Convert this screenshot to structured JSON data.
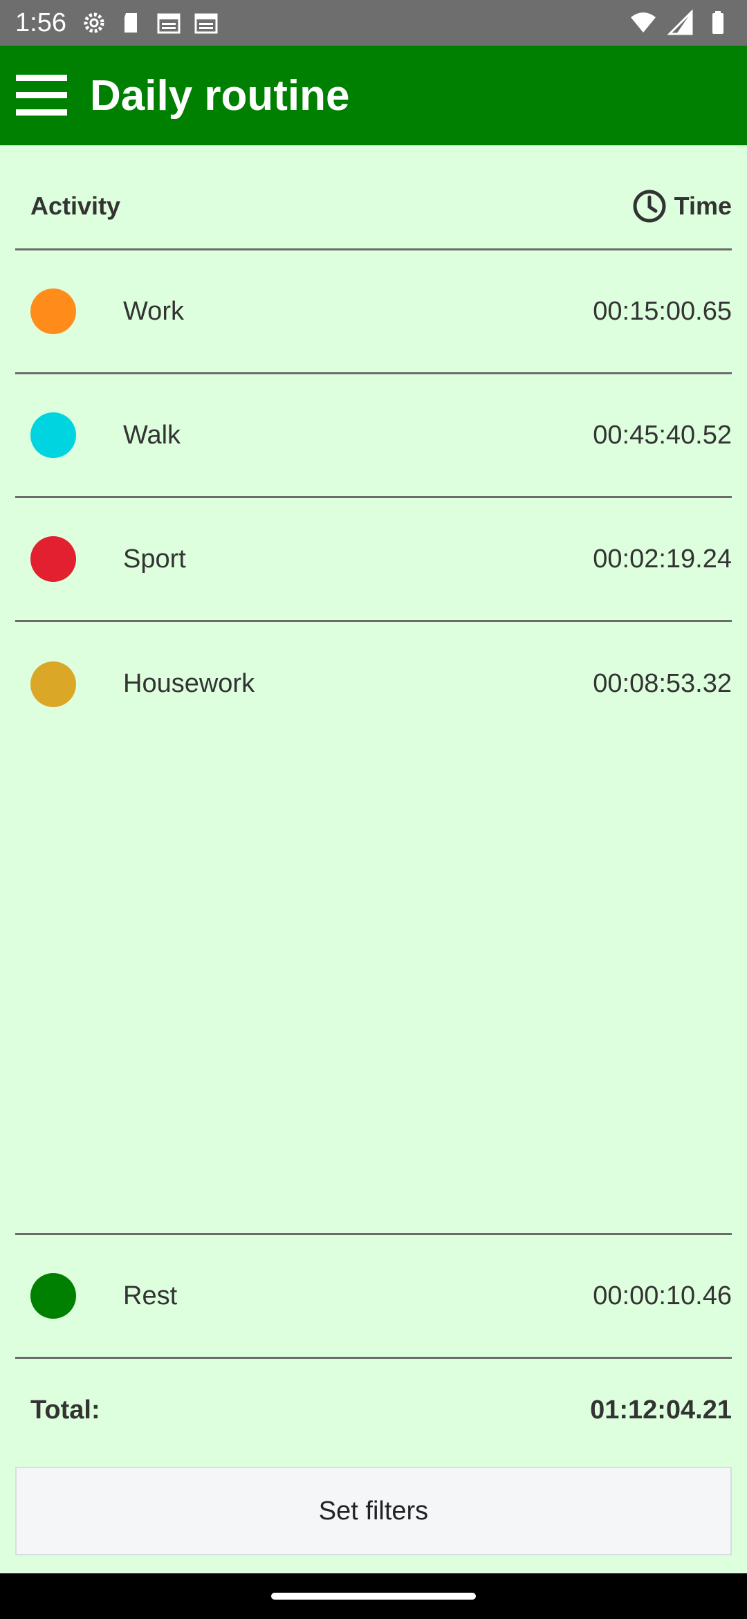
{
  "status_bar": {
    "time": "1:56",
    "left_icons": [
      "gear-icon",
      "sd-card-icon",
      "calendar-icon",
      "calendar-icon"
    ],
    "right_icons": [
      "wifi-icon",
      "signal-icon",
      "battery-icon"
    ]
  },
  "app_bar": {
    "title": "Daily routine",
    "menu_icon": "hamburger-menu-icon",
    "color": "#008000"
  },
  "table": {
    "header_activity": "Activity",
    "header_time": "Time",
    "time_icon": "clock-icon",
    "rows": [
      {
        "name": "Work",
        "time": "00:15:00.65",
        "color": "#ff8c1a"
      },
      {
        "name": "Walk",
        "time": "00:45:40.52",
        "color": "#00d4e0"
      },
      {
        "name": "Sport",
        "time": "00:02:19.24",
        "color": "#e3202f"
      },
      {
        "name": "Housework",
        "time": "00:08:53.32",
        "color": "#dba726"
      }
    ],
    "rest": {
      "name": "Rest",
      "time": "00:00:10.46",
      "color": "#008000"
    },
    "total_label": "Total:",
    "total_value": "01:12:04.21"
  },
  "actions": {
    "filters_label": "Set filters"
  },
  "background": "#ddffdd"
}
